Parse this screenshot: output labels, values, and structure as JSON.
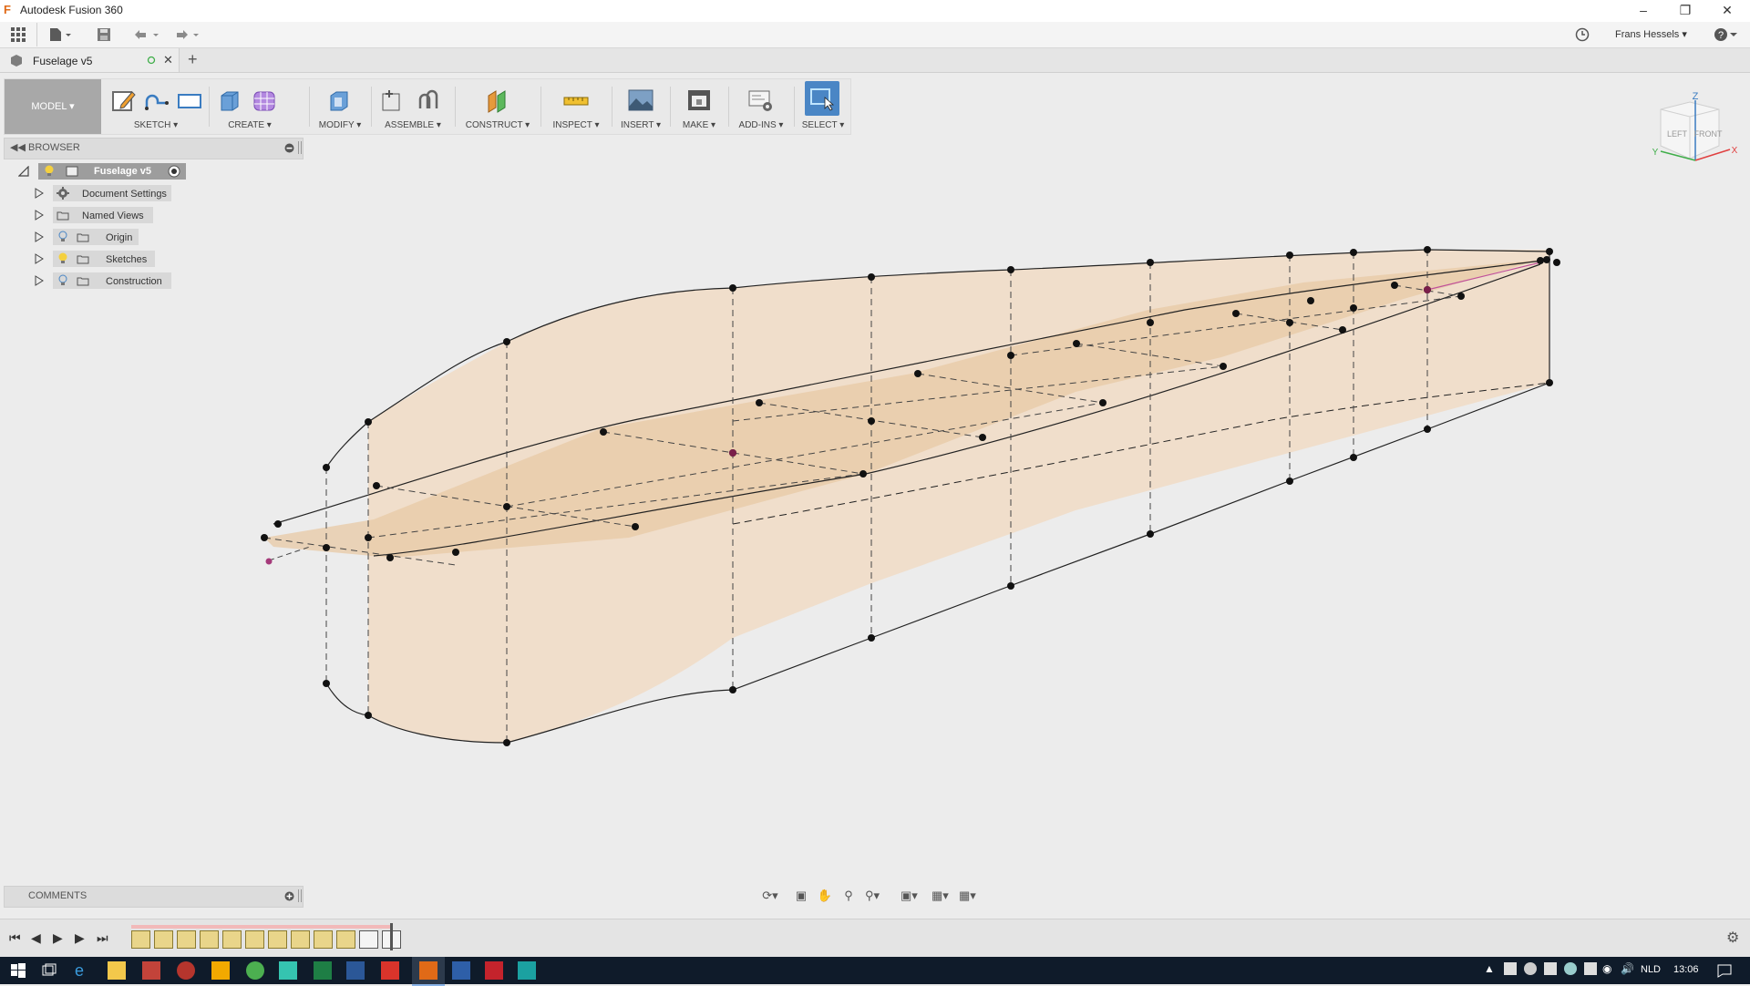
{
  "window": {
    "title": "Autodesk Fusion 360",
    "app_icon_glyph": "F"
  },
  "quickbar": {
    "user_name": "Frans Hessels ▾",
    "help_label": "? ▾"
  },
  "document_tab": {
    "name": "Fusion​age v5",
    "name_clean": "Fuselage v5",
    "close": "✕",
    "add": "+"
  },
  "toolbar": {
    "workspace": "MODEL ▾",
    "groups": [
      {
        "label": "SKETCH ▾"
      },
      {
        "label": "CREATE ▾"
      },
      {
        "label": "MODIFY ▾"
      },
      {
        "label": "ASSEMBLE ▾"
      },
      {
        "label": "CONSTRUCT ▾"
      },
      {
        "label": "INSPECT ▾"
      },
      {
        "label": "INSERT ▾"
      },
      {
        "label": "MAKE ▾"
      },
      {
        "label": "ADD-INS ▾"
      },
      {
        "label": "SELECT ▾"
      }
    ]
  },
  "browser": {
    "title": "BROWSER",
    "root": "Fuselage v5",
    "items": [
      {
        "label": "Document Settings",
        "icon": "gear-icon"
      },
      {
        "label": "Named Views",
        "icon": "folder-icon"
      },
      {
        "label": "Origin",
        "icon": "folder-icon"
      },
      {
        "label": "Sketches",
        "icon": "folder-icon"
      },
      {
        "label": "Construction",
        "icon": "folder-icon"
      }
    ]
  },
  "viewcube": {
    "top": "Z",
    "left": "LEFT",
    "front": "FRONT",
    "x": "X",
    "y": "Y"
  },
  "comments": {
    "title": "COMMENTS"
  },
  "taskbar": {
    "language": "NLD",
    "time": "13:06"
  },
  "colors": {
    "accent": "#3a7cc1",
    "select_active": "#4a86c5",
    "surface_fill": "#f1dcc6",
    "model_button": "#a8a8a8",
    "taskbar": "#0f1b2a"
  }
}
